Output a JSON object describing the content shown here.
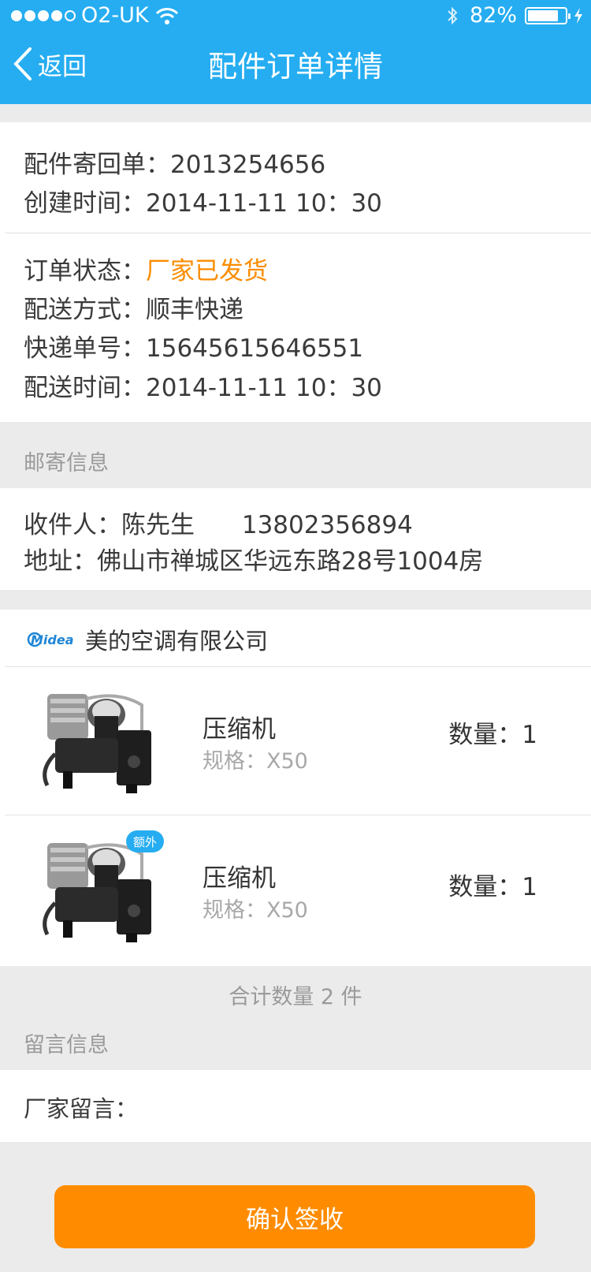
{
  "status_bar": {
    "carrier": "O2-UK",
    "battery": "82%",
    "battery_level": 0.82
  },
  "nav": {
    "back_label": "返回",
    "title": "配件订单详情"
  },
  "order": {
    "return_no": "配件寄回单：2013254656",
    "created": "创建时间：2014-11-11  10：30",
    "status_label": "订单状态：",
    "status_value": "厂家已发货",
    "delivery_method": "配送方式：顺丰快递",
    "tracking_no": "快递单号：15645615646551",
    "delivery_time": "配送时间：2014-11-11  10：30"
  },
  "mail": {
    "section_title": "邮寄信息",
    "recipient": "收件人：陈先生",
    "phone": "13802356894",
    "address": "地址：佛山市禅城区华远东路28号1004房"
  },
  "vendor": {
    "logo_text": "Midea",
    "name": "美的空调有限公司"
  },
  "products": [
    {
      "name": "压缩机",
      "spec": "规格：X50",
      "qty": "数量：1",
      "badge": ""
    },
    {
      "name": "压缩机",
      "spec": "规格：X50",
      "qty": "数量：1",
      "badge": "额外"
    }
  ],
  "total": "合计数量 2 件",
  "message": {
    "section_title": "留言信息",
    "factory_message": "厂家留言："
  },
  "confirm_button": "确认签收",
  "colors": {
    "header": "#26adf1",
    "accent_orange": "#fb8c00",
    "button": "#ff8c00"
  }
}
